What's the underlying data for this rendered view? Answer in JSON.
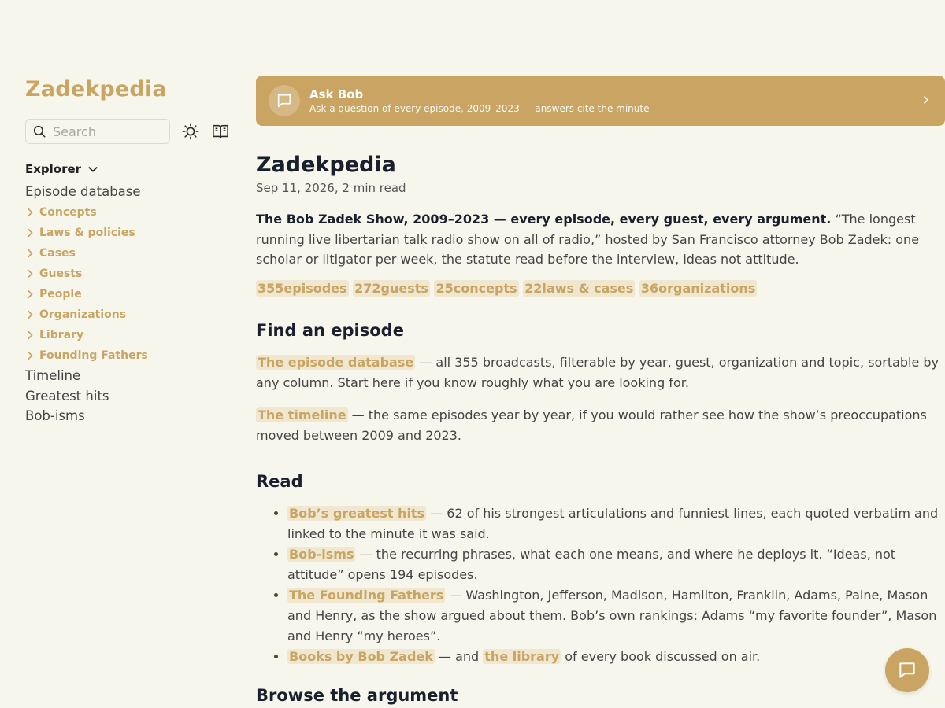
{
  "site": {
    "title": "Zadekpedia"
  },
  "search": {
    "placeholder": "Search"
  },
  "explorer": {
    "label": "Explorer",
    "top_item": "Episode database",
    "folders": [
      "Concepts",
      "Laws & policies",
      "Cases",
      "Guests",
      "People",
      "Organizations",
      "Library",
      "Founding Fathers"
    ],
    "items": [
      "Timeline",
      "Greatest hits",
      "Bob-isms"
    ]
  },
  "askbob": {
    "title": "Ask Bob",
    "subtitle": "Ask a question of every episode, 2009–2023 — answers cite the minute"
  },
  "page": {
    "title": "Zadekpedia",
    "date": "Sep 11, 2026,",
    "read_time": "2 min read",
    "intro_bold": "The Bob Zadek Show, 2009–2023 — every episode, every guest, every argument.",
    "intro_rest": " “The longest running live libertarian talk radio show on all of radio,” hosted by San Francisco attorney Bob Zadek: one scholar or litigator per week, the statute read before the interview, ideas not attitude.",
    "stats": [
      "355episodes",
      "272guests",
      "25concepts",
      "22laws & cases",
      "36organizations"
    ]
  },
  "find": {
    "heading": "Find an episode",
    "db_link": "The episode database",
    "db_text": " — all 355 broadcasts, filterable by year, guest, organization and topic, sortable by any column. Start here if you know roughly what you are looking for.",
    "timeline_link": "The timeline",
    "timeline_text": " — the same episodes year by year, if you would rather see how the show’s preoccupations moved between 2009 and 2023."
  },
  "read": {
    "heading": "Read",
    "items": [
      {
        "link": "Bob’s greatest hits",
        "text": " — 62 of his strongest articulations and funniest lines, each quoted verbatim and linked to the minute it was said."
      },
      {
        "link": "Bob-isms",
        "text": " — the recurring phrases, what each one means, and where he deploys it. “Ideas, not attitude” opens 194 episodes."
      },
      {
        "link": "The Founding Fathers",
        "text": " — Washington, Jefferson, Madison, Hamilton, Franklin, Adams, Paine, Mason and Henry, as the show argued about them. Bob’s own rankings: Adams “my favorite founder”, Mason and Henry “my heroes”."
      },
      {
        "link": "Books by Bob Zadek",
        "text": " — and ",
        "link2": "the library",
        "text2": " of every book discussed on air."
      }
    ]
  },
  "browse": {
    "heading": "Browse the argument"
  },
  "colors": {
    "accent": "#c9a462",
    "background": "#f7f6ec",
    "pill_bg": "#efe7cf",
    "heading": "#1a1f2e"
  }
}
